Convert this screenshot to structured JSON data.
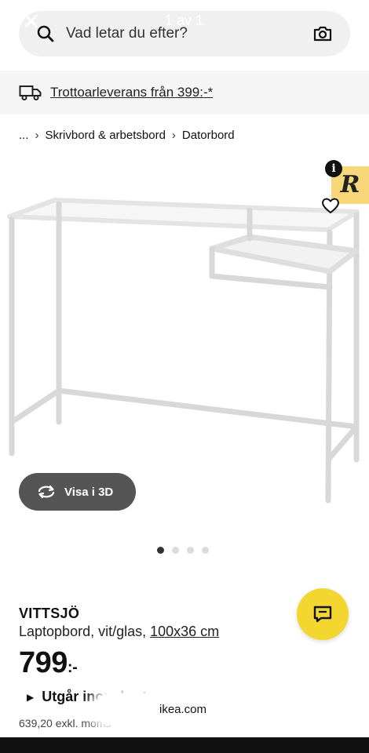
{
  "overlay": {
    "counter": "1 av 1"
  },
  "search": {
    "placeholder": "Vad letar du efter?"
  },
  "delivery": {
    "text": "Trottoarleverans från 399:-*"
  },
  "breadcrumb": {
    "ellipsis": "...",
    "items": [
      "Skrivbord & arbetsbord",
      "Datorbord"
    ]
  },
  "view3d": {
    "label": "Visa i 3D"
  },
  "carousel": {
    "count": 4,
    "active": 1
  },
  "product": {
    "name": "VITTSJÖ",
    "description": "Laptopbord, vit/glas,",
    "dimensions": "100x36 cm",
    "price": "799",
    "price_suffix": ":-",
    "status": "Utgår inom kort",
    "price_excl": "639,20 exkl. moms"
  },
  "browser": {
    "url": "ikea.com"
  },
  "colors": {
    "accent_yellow": "#f3d730",
    "badge": "#f7d77a",
    "button_gray": "#555555"
  },
  "icons": [
    "close-icon",
    "search-icon",
    "camera-icon",
    "truck-icon",
    "info-icon",
    "heart-icon",
    "rotate-icon",
    "chat-icon"
  ]
}
